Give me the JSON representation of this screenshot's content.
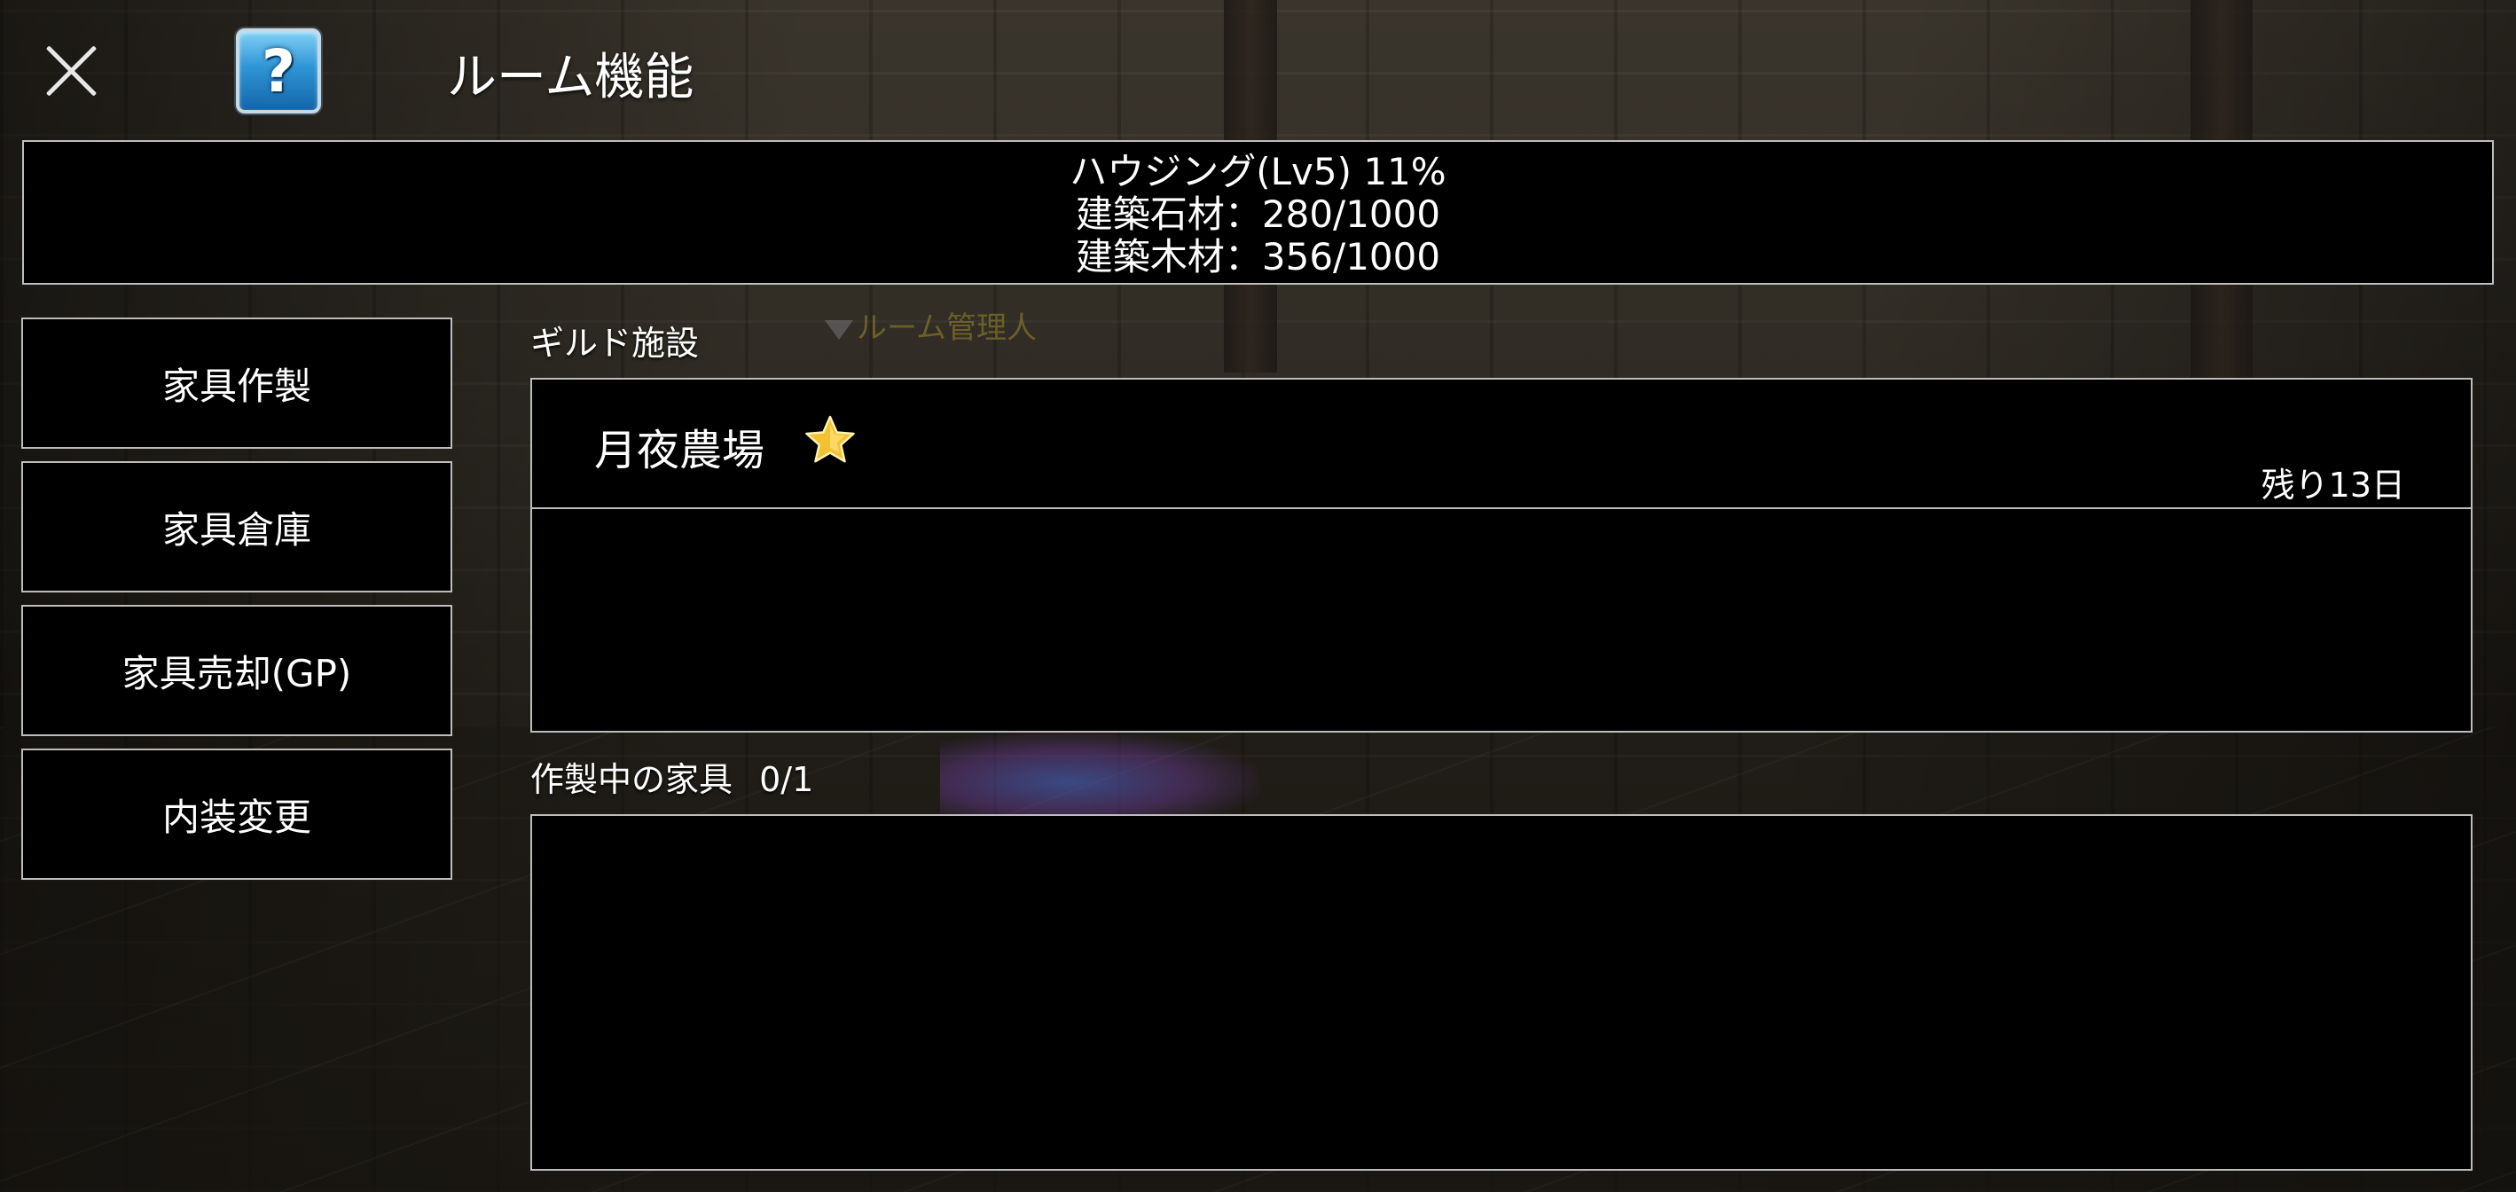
{
  "header": {
    "title": "ルーム機能"
  },
  "housing": {
    "level_line": "ハウジング(Lv5) 11%",
    "stone_line": "建築石材：280/1000",
    "wood_line": "建築木材：356/1000",
    "level_progress_percent": 11,
    "stone_current": 280,
    "stone_max": 1000,
    "wood_current": 356,
    "wood_max": 1000
  },
  "sidebar": {
    "items": [
      {
        "label": "家具作製"
      },
      {
        "label": "家具倉庫"
      },
      {
        "label": "家具売却(GP)"
      },
      {
        "label": "内装変更"
      }
    ]
  },
  "guild_facilities": {
    "label": "ギルド施設",
    "npc_name": "ルーム管理人",
    "items": [
      {
        "name": "月夜農場",
        "remaining": "残り13日",
        "icon": "star-icon"
      }
    ]
  },
  "crafting": {
    "label": "作製中の家具",
    "count": "0/1"
  },
  "colors": {
    "panel_bg": "#000000",
    "panel_border": "#bdbdbd",
    "star": "#f2c230",
    "help_icon": "#2f95d6"
  }
}
